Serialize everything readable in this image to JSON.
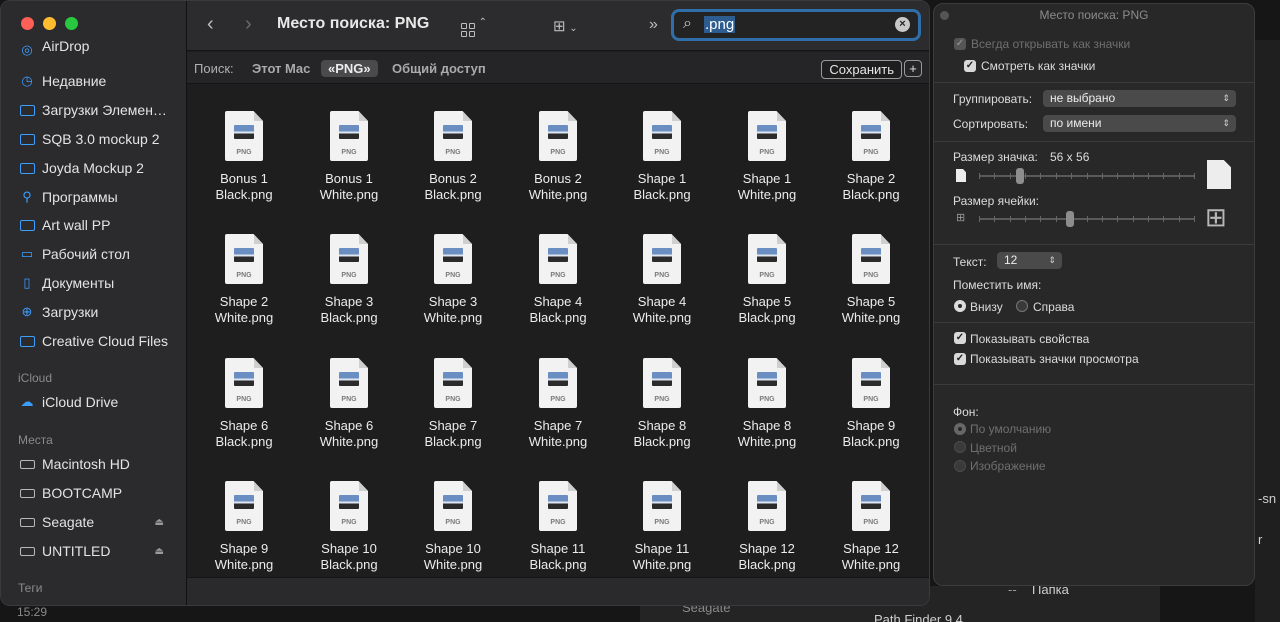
{
  "sidebar": {
    "items": [
      {
        "label": "AirDrop",
        "icon": "airdrop-icon"
      },
      {
        "label": "Недавние",
        "icon": "clock-icon"
      },
      {
        "label": "Загрузки Элемен…",
        "icon": "folder-icon"
      },
      {
        "label": "SQB 3.0 mockup 2",
        "icon": "folder-icon"
      },
      {
        "label": "Joyda Mockup 2",
        "icon": "folder-icon"
      },
      {
        "label": "Программы",
        "icon": "apps-icon"
      },
      {
        "label": "Art wall PP",
        "icon": "folder-icon"
      },
      {
        "label": "Рабочий стол",
        "icon": "desktop-icon"
      },
      {
        "label": "Документы",
        "icon": "document-icon"
      },
      {
        "label": "Загрузки",
        "icon": "download-icon"
      },
      {
        "label": "Creative Cloud Files",
        "icon": "folder-icon"
      }
    ],
    "icloud_heading": "iCloud",
    "icloud_drive": "iCloud Drive",
    "places_heading": "Места",
    "places": [
      {
        "label": "Macintosh HD",
        "eject": false
      },
      {
        "label": "BOOTCAMP",
        "eject": false
      },
      {
        "label": "Seagate",
        "eject": true
      },
      {
        "label": "UNTITLED",
        "eject": true
      }
    ],
    "tags_heading": "Теги",
    "time": "15:29"
  },
  "toolbar": {
    "title": "Место поиска: PNG",
    "search_query": ".png"
  },
  "scope": {
    "label": "Поиск:",
    "this_mac": "Этот Mac",
    "png": "«PNG»",
    "shared": "Общий доступ",
    "save": "Сохранить",
    "add": "+"
  },
  "files": [
    {
      "line1": "Bonus 1",
      "line2": "Black.png"
    },
    {
      "line1": "Bonus 1",
      "line2": "White.png"
    },
    {
      "line1": "Bonus 2",
      "line2": "Black.png"
    },
    {
      "line1": "Bonus 2",
      "line2": "White.png"
    },
    {
      "line1": "Shape 1",
      "line2": "Black.png"
    },
    {
      "line1": "Shape 1",
      "line2": "White.png"
    },
    {
      "line1": "Shape 2",
      "line2": "Black.png"
    },
    {
      "line1": "Shape 2",
      "line2": "White.png"
    },
    {
      "line1": "Shape 3",
      "line2": "Black.png"
    },
    {
      "line1": "Shape 3",
      "line2": "White.png"
    },
    {
      "line1": "Shape 4",
      "line2": "Black.png"
    },
    {
      "line1": "Shape 4",
      "line2": "White.png"
    },
    {
      "line1": "Shape 5",
      "line2": "Black.png"
    },
    {
      "line1": "Shape 5",
      "line2": "White.png"
    },
    {
      "line1": "Shape 6",
      "line2": "Black.png"
    },
    {
      "line1": "Shape 6",
      "line2": "White.png"
    },
    {
      "line1": "Shape 7",
      "line2": "Black.png"
    },
    {
      "line1": "Shape 7",
      "line2": "White.png"
    },
    {
      "line1": "Shape 8",
      "line2": "Black.png"
    },
    {
      "line1": "Shape 8",
      "line2": "White.png"
    },
    {
      "line1": "Shape 9",
      "line2": "Black.png"
    },
    {
      "line1": "Shape 9",
      "line2": "White.png"
    },
    {
      "line1": "Shape 10",
      "line2": "Black.png"
    },
    {
      "line1": "Shape 10",
      "line2": "White.png"
    },
    {
      "line1": "Shape 11",
      "line2": "Black.png"
    },
    {
      "line1": "Shape 11",
      "line2": "White.png"
    },
    {
      "line1": "Shape 12",
      "line2": "Black.png"
    },
    {
      "line1": "Shape 12",
      "line2": "White.png"
    }
  ],
  "file_ext": "PNG",
  "panel": {
    "title": "Место поиска: PNG",
    "always_open_icons": "Всегда открывать как значки",
    "view_as_icons": "Смотреть как значки",
    "group_label": "Группировать:",
    "group_value": "не выбрано",
    "sort_label": "Сортировать:",
    "sort_value": "по имени",
    "icon_size_label": "Размер значка:",
    "icon_size_value": "56 x 56",
    "icon_size_level": 0.18,
    "cell_size_label": "Размер ячейки:",
    "cell_size_level": 0.42,
    "text_label": "Текст:",
    "text_value": "12",
    "label_pos_label": "Поместить имя:",
    "label_bottom": "Внизу",
    "label_right": "Справа",
    "show_props": "Показывать свойства",
    "show_preview": "Показывать значки просмотра",
    "bg_label": "Фон:",
    "bg_default": "По умолчанию",
    "bg_color": "Цветной",
    "bg_image": "Изображение"
  },
  "background": {
    "text1": "Seagate",
    "text2": "Папка",
    "text3": "Path Finder 9.4",
    "text4": "-sn",
    "text5": "r",
    "text6": "--"
  }
}
